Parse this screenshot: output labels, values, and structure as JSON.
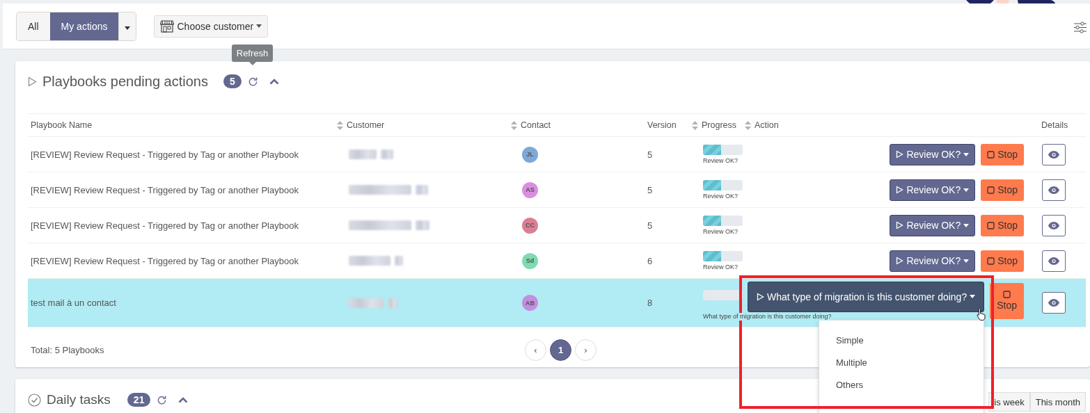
{
  "toolbar": {
    "filter_tabs": [
      {
        "label": "All",
        "selected": false
      },
      {
        "label": "My actions",
        "selected": true
      }
    ],
    "customer_picker": {
      "label": "Choose customer"
    }
  },
  "pending": {
    "title": "Playbooks pending actions",
    "count": "5",
    "tooltip": "Refresh",
    "expanded": true,
    "columns": [
      {
        "label": "Playbook Name",
        "sortable": false
      },
      {
        "label": "Customer",
        "sortable": true
      },
      {
        "label": "Contact",
        "sortable": true
      },
      {
        "label": "Version",
        "sortable": false
      },
      {
        "label": "Progress",
        "sortable": true
      },
      {
        "label": "Action",
        "sortable": true
      },
      {
        "label": "Details",
        "sortable": false
      }
    ],
    "rows": [
      {
        "name": "[REVIEW] Review Request - Triggered by Tag or another Playbook",
        "initials": "JL",
        "color": "#7fa7d9",
        "version": "5",
        "level": 0.45,
        "step": "Review OK?",
        "action": "Review OK?",
        "stop": "Stop",
        "highlighted": false
      },
      {
        "name": "[REVIEW] Review Request - Triggered by Tag or another Playbook",
        "initials": "AS",
        "color": "#d98ee0",
        "version": "5",
        "level": 0.45,
        "step": "Review OK?",
        "action": "Review OK?",
        "stop": "Stop",
        "highlighted": false
      },
      {
        "name": "[REVIEW] Review Request - Triggered by Tag or another Playbook",
        "initials": "CC",
        "color": "#d97f94",
        "version": "5",
        "level": 0.45,
        "step": "Review OK?",
        "action": "Review OK?",
        "stop": "Stop",
        "highlighted": false
      },
      {
        "name": "[REVIEW] Review Request - Triggered by Tag or another Playbook",
        "initials": "Sd",
        "color": "#7fdbb0",
        "version": "6",
        "level": 0.45,
        "step": "Review OK?",
        "action": "Review OK?",
        "stop": "Stop",
        "highlighted": false
      },
      {
        "name": "test mail à un contact",
        "initials": "AB",
        "color": "#c48de0",
        "version": "8",
        "level": 0,
        "step": "What type of migration is this customer doing?",
        "action": "What type of migration is this customer doing?",
        "stop": "Stop",
        "highlighted": true,
        "menu_items": [
          "Simple",
          "Multiple",
          "Others"
        ]
      }
    ],
    "total": "Total: 5 Playbooks",
    "prev": "‹",
    "next": "›",
    "pages": [
      {
        "label": "1",
        "selected": true
      }
    ]
  },
  "daily": {
    "title": "Daily tasks",
    "count": "21",
    "expanded": true,
    "periods": [
      {
        "label": "is week",
        "selected": false
      },
      {
        "label": "This month",
        "selected": false
      }
    ]
  }
}
